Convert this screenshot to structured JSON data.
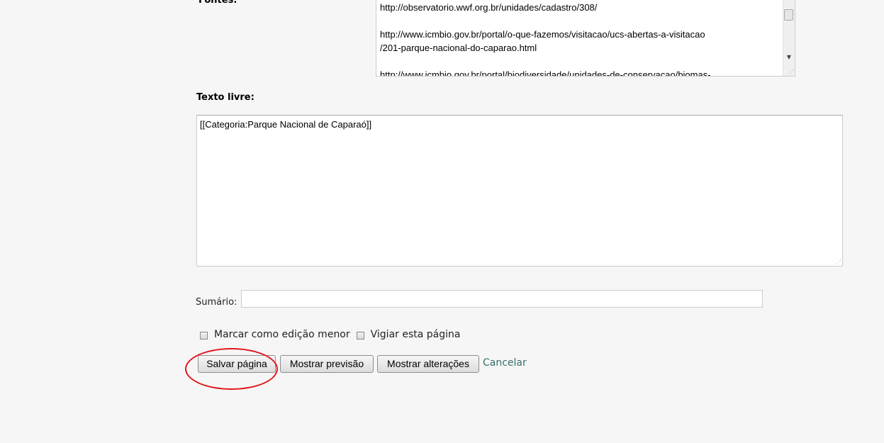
{
  "fontes": {
    "label": "Fontes:",
    "lines": [
      "http://observatorio.wwf.org.br/unidades/cadastro/308/",
      "http://www.icmbio.gov.br/portal/o-que-fazemos/visitacao/ucs-abertas-a-visitacao\n/201-parque-nacional-do-caparao.html",
      "http://www.icmbio.gov.br/portal/biodiversidade/unidades-de-conservacao/biomas-"
    ]
  },
  "texto_livre": {
    "label": "Texto livre:",
    "value": "[[Categoria:Parque Nacional de Caparaó]]"
  },
  "sumario": {
    "label": "Sumário:",
    "value": ""
  },
  "options": {
    "minor_edit_label": "Marcar como edição menor",
    "watch_label": "Vigiar esta página"
  },
  "buttons": {
    "save": "Salvar página",
    "preview": "Mostrar previsão",
    "diff": "Mostrar alterações",
    "cancel": "Cancelar"
  },
  "colors": {
    "link": "#36706b",
    "highlight": "#e2141b",
    "background": "#f6f6f6"
  }
}
